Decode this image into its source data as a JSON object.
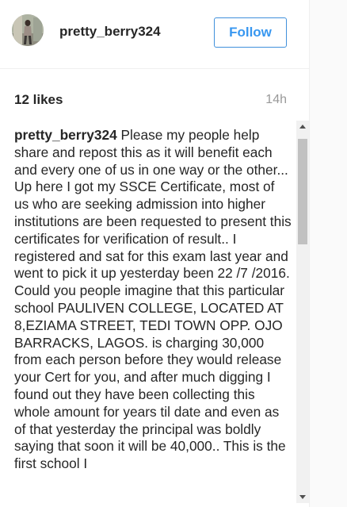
{
  "post": {
    "username": "pretty_berry324",
    "follow_label": "Follow",
    "likes": "12 likes",
    "time": "14h",
    "caption": {
      "author": "pretty_berry324",
      "text": "Please my people help share and repost this as it will benefit each and every one of us in one way or the other... Up here I got my SSCE Certificate, most of us who are seeking admission into higher institutions are been requested to present this certificates for verification of result.. I registered and sat for this exam last year and went to pick it up yesterday been 22 /7 /2016. Could you people imagine that this particular school PAULIVEN COLLEGE, LOCATED AT 8,EZIAMA STREET, TEDI TOWN OPP. OJO BARRACKS, LAGOS. is charging 30,000 from each person before they would release your Cert for you, and after much digging I found out they have been collecting this whole amount for years til date and even as of that yesterday the principal was boldly saying that soon it will be 40,000.. This is the first school I"
    }
  },
  "colors": {
    "follow_blue": "#3897f0",
    "text_dark": "#262626",
    "text_muted": "#999999"
  },
  "icons": {
    "scroll_up": "triangle-up-icon",
    "scroll_down": "triangle-down-icon"
  }
}
